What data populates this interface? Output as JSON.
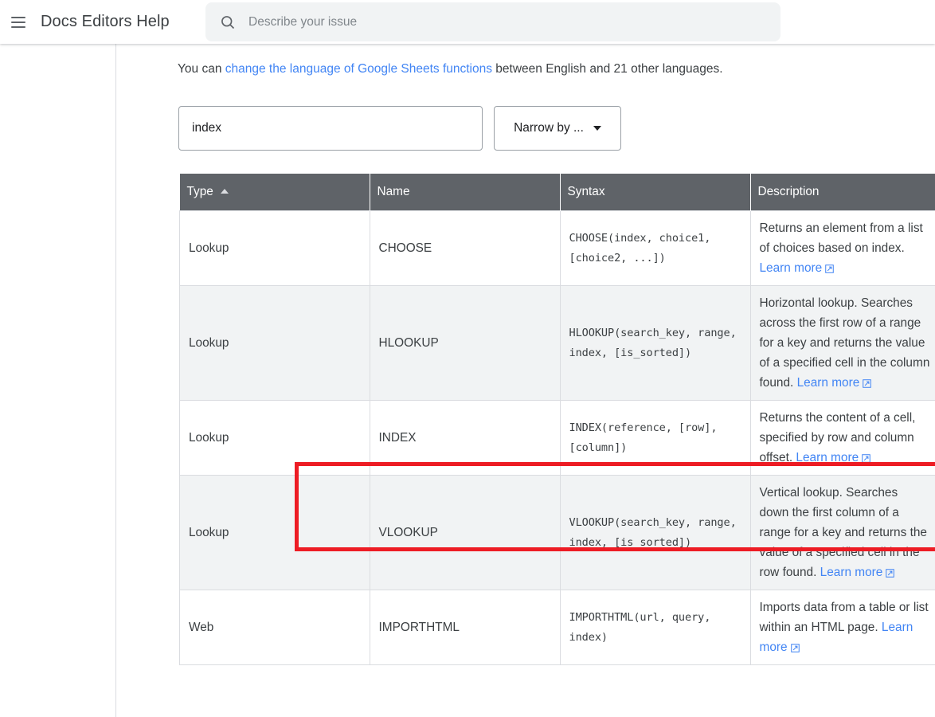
{
  "header": {
    "menu_icon": "hamburger-menu-icon",
    "product_title": "Docs Editors Help",
    "search": {
      "icon": "search-icon",
      "value": "",
      "placeholder": "Describe your issue"
    }
  },
  "main": {
    "intro": {
      "before": "You can ",
      "link": "change the language of Google Sheets functions",
      "after": " between English and 21 other languages."
    },
    "filter": {
      "value": "index",
      "placeholder": ""
    },
    "narrow_by": {
      "label": "Narrow by ...",
      "caret_icon": "chevron-down-icon"
    },
    "table": {
      "columns": [
        {
          "label": "Type",
          "sorted": true,
          "sort_icon": "sort-ascending-icon"
        },
        {
          "label": "Name",
          "sorted": false
        },
        {
          "label": "Syntax",
          "sorted": false
        },
        {
          "label": "Description",
          "sorted": false
        }
      ],
      "rows": [
        {
          "type": "Lookup",
          "name": "CHOOSE",
          "syntax": "CHOOSE(index, choice1, [choice2, ...])",
          "description": "Returns an element from a list of choices based on index.",
          "learn_more": "Learn more",
          "learn_more_icon": "external-link-icon",
          "striped": false,
          "highlighted": false
        },
        {
          "type": "Lookup",
          "name": "HLOOKUP",
          "syntax": "HLOOKUP(search_key, range, index, [is_sorted])",
          "description": "Horizontal lookup. Searches across the first row of a range for a key and returns the value of a specified cell in the column found.",
          "learn_more": "Learn more",
          "learn_more_icon": "external-link-icon",
          "striped": true,
          "highlighted": false
        },
        {
          "type": "Lookup",
          "name": "INDEX",
          "syntax": "INDEX(reference, [row], [column])",
          "description": "Returns the content of a cell, specified by row and column offset.",
          "learn_more": "Learn more",
          "learn_more_icon": "external-link-icon",
          "striped": false,
          "highlighted": true
        },
        {
          "type": "Lookup",
          "name": "VLOOKUP",
          "syntax": "VLOOKUP(search_key, range, index, [is_sorted])",
          "description": "Vertical lookup. Searches down the first column of a range for a key and returns the value of a specified cell in the row found.",
          "learn_more": "Learn more",
          "learn_more_icon": "external-link-icon",
          "striped": true,
          "highlighted": false
        },
        {
          "type": "Web",
          "name": "IMPORTHTML",
          "syntax": "IMPORTHTML(url, query, index)",
          "description": "Imports data from a table or list within an HTML page.",
          "learn_more": "Learn more",
          "learn_more_icon": "external-link-icon",
          "striped": false,
          "highlighted": false
        }
      ]
    }
  },
  "colors": {
    "link": "#4285f4",
    "syntax_green": "#188038",
    "header_gray": "#5f6368",
    "stripe": "#f1f3f4",
    "highlight_red": "#ed1c24",
    "search_bg": "#f1f3f4"
  }
}
